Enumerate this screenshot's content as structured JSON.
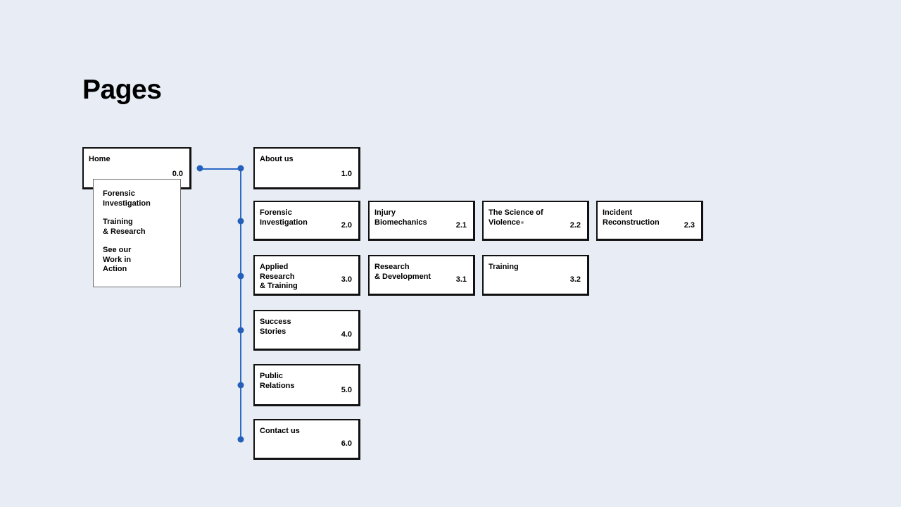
{
  "header": {
    "title": "Pages"
  },
  "colors": {
    "background": "#e8ecf5",
    "node_border": "#111111",
    "node_fill": "#ffffff",
    "connector": "#2460ba",
    "dropdown_border": "#6e6e6e",
    "marker_dot": "#9b9b9b"
  },
  "sitemap": {
    "root": {
      "label": "Home",
      "number": "0.0"
    },
    "dropdown": {
      "items": [
        {
          "label": "Forensic\nInvestigation"
        },
        {
          "label": "Training\n& Research"
        },
        {
          "label": "See our\nWork in\nAction"
        }
      ]
    },
    "rows": [
      {
        "nodes": [
          {
            "label": "About us",
            "number": "1.0"
          }
        ]
      },
      {
        "nodes": [
          {
            "label": "Forensic\nInvestigation",
            "number": "2.0"
          },
          {
            "label": "Injury\nBiomechanics",
            "number": "2.1"
          },
          {
            "label": "The Science of\nViolence",
            "number": "2.2",
            "trailing_marker": true
          },
          {
            "label": "Incident\nReconstruction",
            "number": "2.3"
          }
        ]
      },
      {
        "nodes": [
          {
            "label": "Applied\nResearch\n& Training",
            "number": "3.0"
          },
          {
            "label": "Research\n& Development",
            "number": "3.1"
          },
          {
            "label": "Training",
            "number": "3.2"
          }
        ]
      },
      {
        "nodes": [
          {
            "label": "Success\nStories",
            "number": "4.0"
          }
        ]
      },
      {
        "nodes": [
          {
            "label": "Public\nRelations",
            "number": "5.0"
          }
        ]
      },
      {
        "nodes": [
          {
            "label": "Contact us",
            "number": "6.0"
          }
        ]
      }
    ]
  }
}
